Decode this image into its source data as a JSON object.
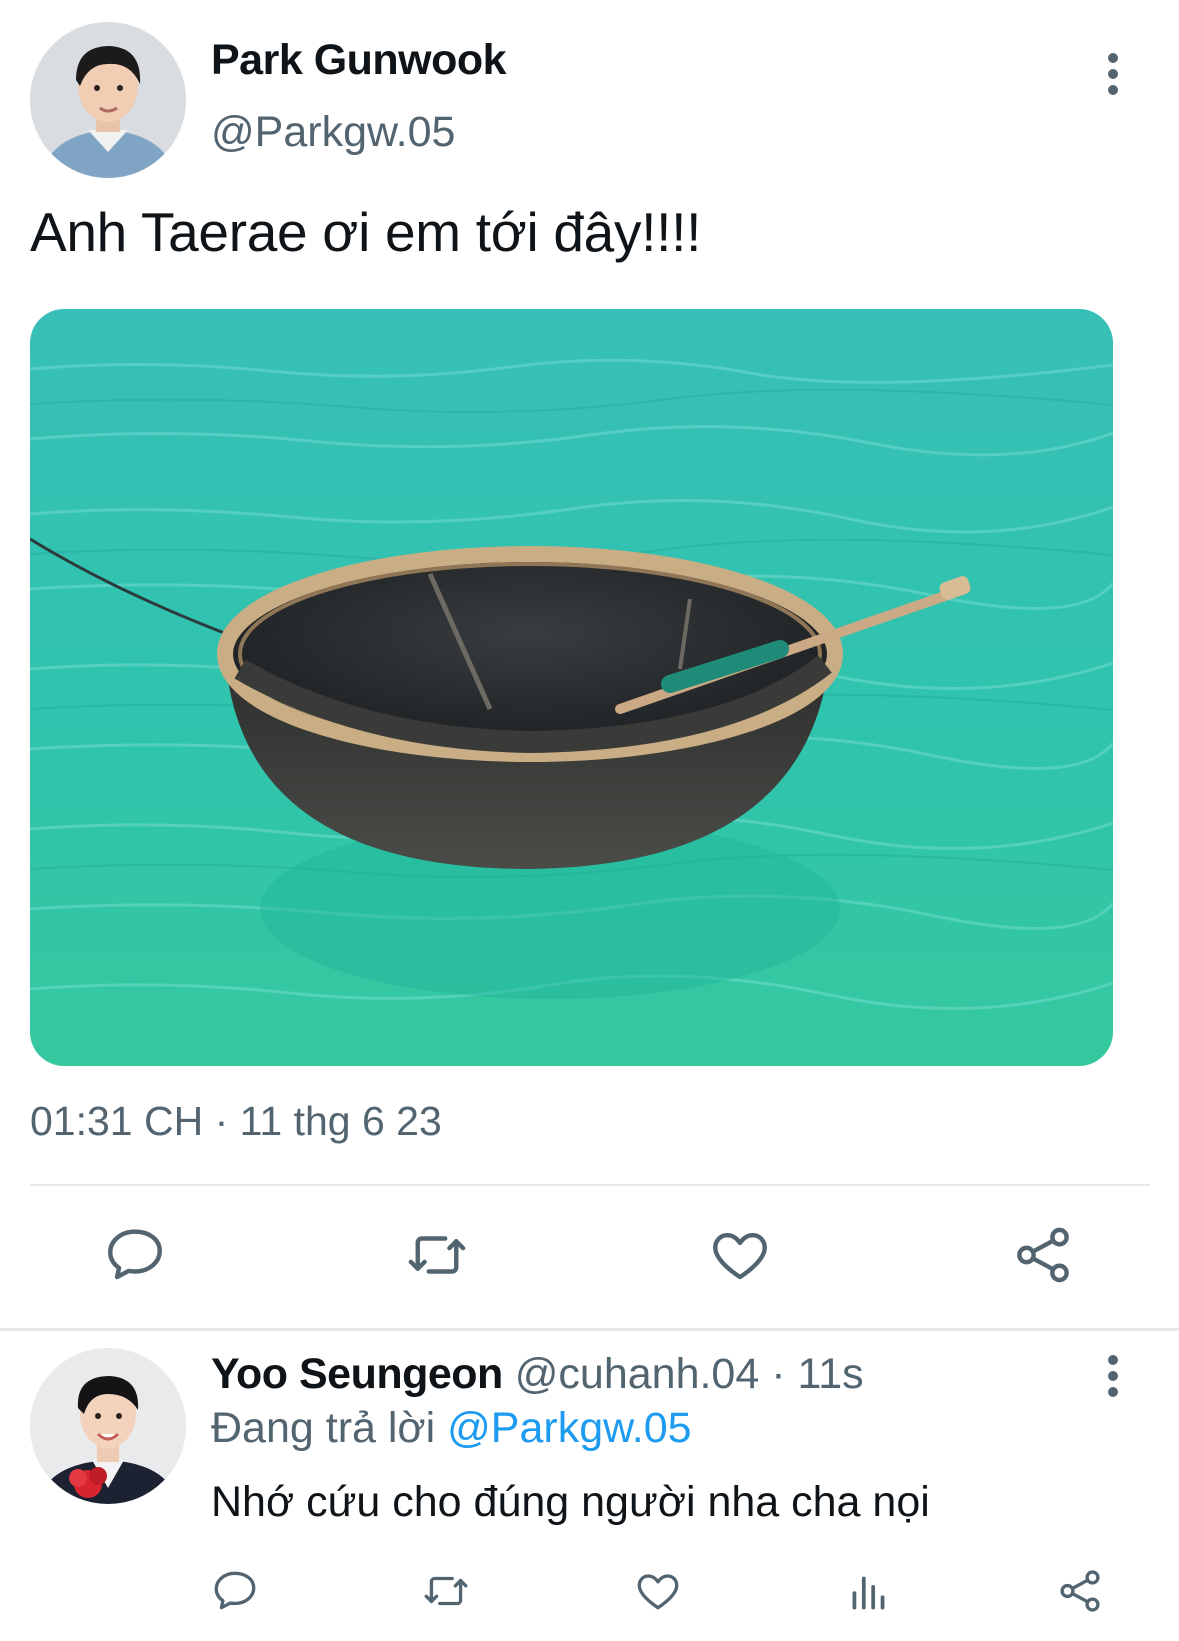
{
  "tweet": {
    "author_name": "Park Gunwook",
    "author_handle": "@Parkgw.05",
    "text": "Anh Taerae ơi em tới đây!!!!",
    "timestamp": "01:31 CH · 11 thg 6 23",
    "more_icon": "more-vertical-icon",
    "media_description_icon": "photo"
  },
  "actions": [
    {
      "name": "reply",
      "icon": "speech-bubble-icon"
    },
    {
      "name": "retweet",
      "icon": "retweet-icon"
    },
    {
      "name": "like",
      "icon": "heart-icon"
    },
    {
      "name": "share",
      "icon": "share-icon"
    }
  ],
  "reply": {
    "author_name": "Yoo Seungeon",
    "author_handle": "@cuhanh.04",
    "separator": " · ",
    "time": "11s",
    "replying_prefix": "Đang trả lời ",
    "replying_to": "@Parkgw.05",
    "text": "Nhớ cứu cho đúng người nha cha nọi",
    "actions": [
      {
        "name": "reply",
        "icon": "speech-bubble-icon"
      },
      {
        "name": "retweet",
        "icon": "retweet-icon"
      },
      {
        "name": "like",
        "icon": "heart-icon"
      },
      {
        "name": "views",
        "icon": "bar-chart-icon"
      },
      {
        "name": "share",
        "icon": "share-icon"
      }
    ]
  },
  "colors": {
    "text": "#0f1419",
    "secondary": "#536471",
    "link": "#1d9bf0",
    "divider": "#e6e9ec",
    "water": "#2fc0b4"
  }
}
